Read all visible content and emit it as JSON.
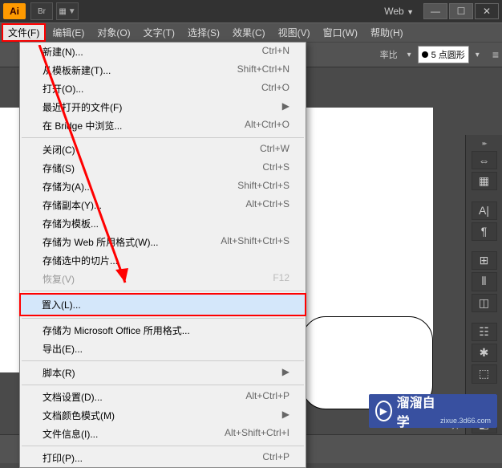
{
  "titlebar": {
    "logo": "Ai",
    "btn_br": "Br",
    "web_label": "Web"
  },
  "menubar": {
    "items": [
      "文件(F)",
      "编辑(E)",
      "对象(O)",
      "文字(T)",
      "选择(S)",
      "效果(C)",
      "视图(V)",
      "窗口(W)",
      "帮助(H)"
    ]
  },
  "toolbar": {
    "ratio_label": "率比",
    "stroke_select": "5 点圆形"
  },
  "file_menu": {
    "items": [
      {
        "label": "新建(N)...",
        "shortcut": "Ctrl+N"
      },
      {
        "label": "从模板新建(T)...",
        "shortcut": "Shift+Ctrl+N"
      },
      {
        "label": "打开(O)...",
        "shortcut": "Ctrl+O"
      },
      {
        "label": "最近打开的文件(F)",
        "submenu": true
      },
      {
        "label": "在 Bridge 中浏览...",
        "shortcut": "Alt+Ctrl+O"
      },
      {
        "sep": true
      },
      {
        "label": "关闭(C)",
        "shortcut": "Ctrl+W"
      },
      {
        "label": "存储(S)",
        "shortcut": "Ctrl+S"
      },
      {
        "label": "存储为(A)...",
        "shortcut": "Shift+Ctrl+S"
      },
      {
        "label": "存储副本(Y)...",
        "shortcut": "Alt+Ctrl+S"
      },
      {
        "label": "存储为模板...",
        "shortcut": ""
      },
      {
        "label": "存储为 Web 所用格式(W)...",
        "shortcut": "Alt+Shift+Ctrl+S"
      },
      {
        "label": "存储选中的切片...",
        "shortcut": ""
      },
      {
        "label": "恢复(V)",
        "shortcut": "F12",
        "disabled": true
      },
      {
        "sep": true
      },
      {
        "label": "置入(L)...",
        "highlighted": true
      },
      {
        "sep": true
      },
      {
        "label": "存储为 Microsoft Office 所用格式...",
        "shortcut": ""
      },
      {
        "label": "导出(E)...",
        "shortcut": ""
      },
      {
        "sep": true
      },
      {
        "label": "脚本(R)",
        "submenu": true
      },
      {
        "sep": true
      },
      {
        "label": "文档设置(D)...",
        "shortcut": "Alt+Ctrl+P"
      },
      {
        "label": "文档颜色模式(M)",
        "submenu": true
      },
      {
        "label": "文件信息(I)...",
        "shortcut": "Alt+Shift+Ctrl+I"
      },
      {
        "sep": true
      },
      {
        "label": "打印(P)...",
        "shortcut": "Ctrl+P"
      }
    ]
  },
  "bottom_right": "择",
  "watermark": {
    "text": "溜溜自学",
    "sub": "zixue.3d66.com"
  }
}
